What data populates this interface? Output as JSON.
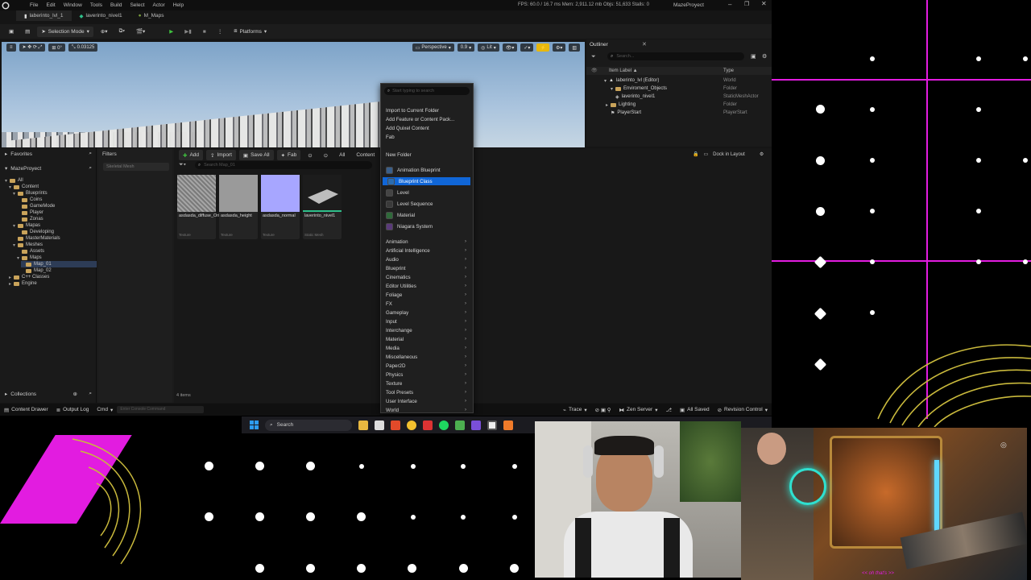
{
  "titlebar": {
    "menus": [
      "File",
      "Edit",
      "Window",
      "Tools",
      "Build",
      "Select",
      "Actor",
      "Help"
    ],
    "stats": "FPS: 60.0 / 16.7 ms  Mem: 2,911.12 mb  Objs: 51,633  Stalls: 0",
    "project_name": "MazeProyect"
  },
  "doc_tabs": [
    "laberinto_lvl_1",
    "laverinto_nivel1",
    "M_Maps"
  ],
  "toolbar": {
    "selection_mode": "Selection Mode",
    "platforms": "Platforms"
  },
  "viewport": {
    "perspective": "Perspective",
    "lit": "Lit",
    "snap_value": "0.03125",
    "fov_value": "0.9"
  },
  "outliner": {
    "title": "Outliner",
    "search_placeholder": "Search...",
    "col_label": "Item Label ▲",
    "col_type": "Type",
    "rows": [
      {
        "label": "laberinto_lvl (Editor)",
        "type": "World"
      },
      {
        "label": "Enviroment_Objects",
        "type": "Folder"
      },
      {
        "label": "laverinto_nivel1",
        "type": "StaticMeshActor"
      },
      {
        "label": "Lighting",
        "type": "Folder"
      },
      {
        "label": "PlayerStart",
        "type": "PlayerStart"
      }
    ]
  },
  "content_browser": {
    "favorites": "Favorites",
    "project": "MazeProyect",
    "filters": "Filters",
    "filter_search": "Skeletal Mesh",
    "add": "Add",
    "import": "Import",
    "save_all": "Save All",
    "fab": "Fab",
    "path_all": "All",
    "path_content": "Content",
    "search_placeholder": "Search Map_01",
    "dock_in_layout": "Dock in Layout",
    "collections": "Collections",
    "item_count": "4 items",
    "tree": [
      {
        "label": "All",
        "depth": 0
      },
      {
        "label": "Content",
        "depth": 1
      },
      {
        "label": "Blueprints",
        "depth": 2
      },
      {
        "label": "Coins",
        "depth": 3
      },
      {
        "label": "GameMode",
        "depth": 3
      },
      {
        "label": "Player",
        "depth": 3
      },
      {
        "label": "Zonas",
        "depth": 3
      },
      {
        "label": "Mapas",
        "depth": 2
      },
      {
        "label": "Developing",
        "depth": 3
      },
      {
        "label": "MasterMaterials",
        "depth": 2
      },
      {
        "label": "Meshes",
        "depth": 2
      },
      {
        "label": "Assets",
        "depth": 3
      },
      {
        "label": "Maps",
        "depth": 3
      },
      {
        "label": "Map_01",
        "depth": 4
      },
      {
        "label": "Map_02",
        "depth": 4
      },
      {
        "label": "C++ Classes",
        "depth": 1
      },
      {
        "label": "Engine",
        "depth": 1
      }
    ],
    "assets": [
      {
        "name": "asdasda_diffuse_Original",
        "kind": "Texture",
        "color": "#8a8a8a"
      },
      {
        "name": "asdasda_height",
        "kind": "Texture",
        "color": "#9a9a9a"
      },
      {
        "name": "asdasda_normal",
        "kind": "Texture",
        "color": "#a7a6ff"
      },
      {
        "name": "laverinto_nivel1",
        "kind": "Static Mesh",
        "color": "#1c1c1c"
      }
    ]
  },
  "statusbar": {
    "content_drawer": "Content Drawer",
    "output_log": "Output Log",
    "cmd": "Cmd",
    "console_placeholder": "Enter Console Command",
    "trace": "Trace",
    "zen_server": "Zen Server",
    "all_saved": "All Saved",
    "revision_control": "Revision Control"
  },
  "context_menu": {
    "search_placeholder": "Start typing to search",
    "top_items": [
      "Import to Current Folder",
      "Add Feature or Content Pack...",
      "Add Quixel Content",
      "Fab"
    ],
    "folder_item": "New Folder",
    "asset_items": [
      "Animation Blueprint",
      "Blueprint Class",
      "Level",
      "Level Sequence",
      "Material",
      "Niagara System"
    ],
    "highlighted": "Blueprint Class",
    "submenus": [
      "Animation",
      "Artificial Intelligence",
      "Audio",
      "Blueprint",
      "Cinematics",
      "Editor Utilities",
      "Foliage",
      "FX",
      "Gameplay",
      "Input",
      "Interchange",
      "Material",
      "Media",
      "Miscellaneous",
      "Paper2D",
      "Physics",
      "Texture",
      "Tool Presets",
      "User Interface",
      "World"
    ]
  },
  "taskbar": {
    "search": "Search"
  },
  "stream_overlay": {
    "accent": "#e21ce0",
    "game_caption": "<< oh that's >>"
  }
}
